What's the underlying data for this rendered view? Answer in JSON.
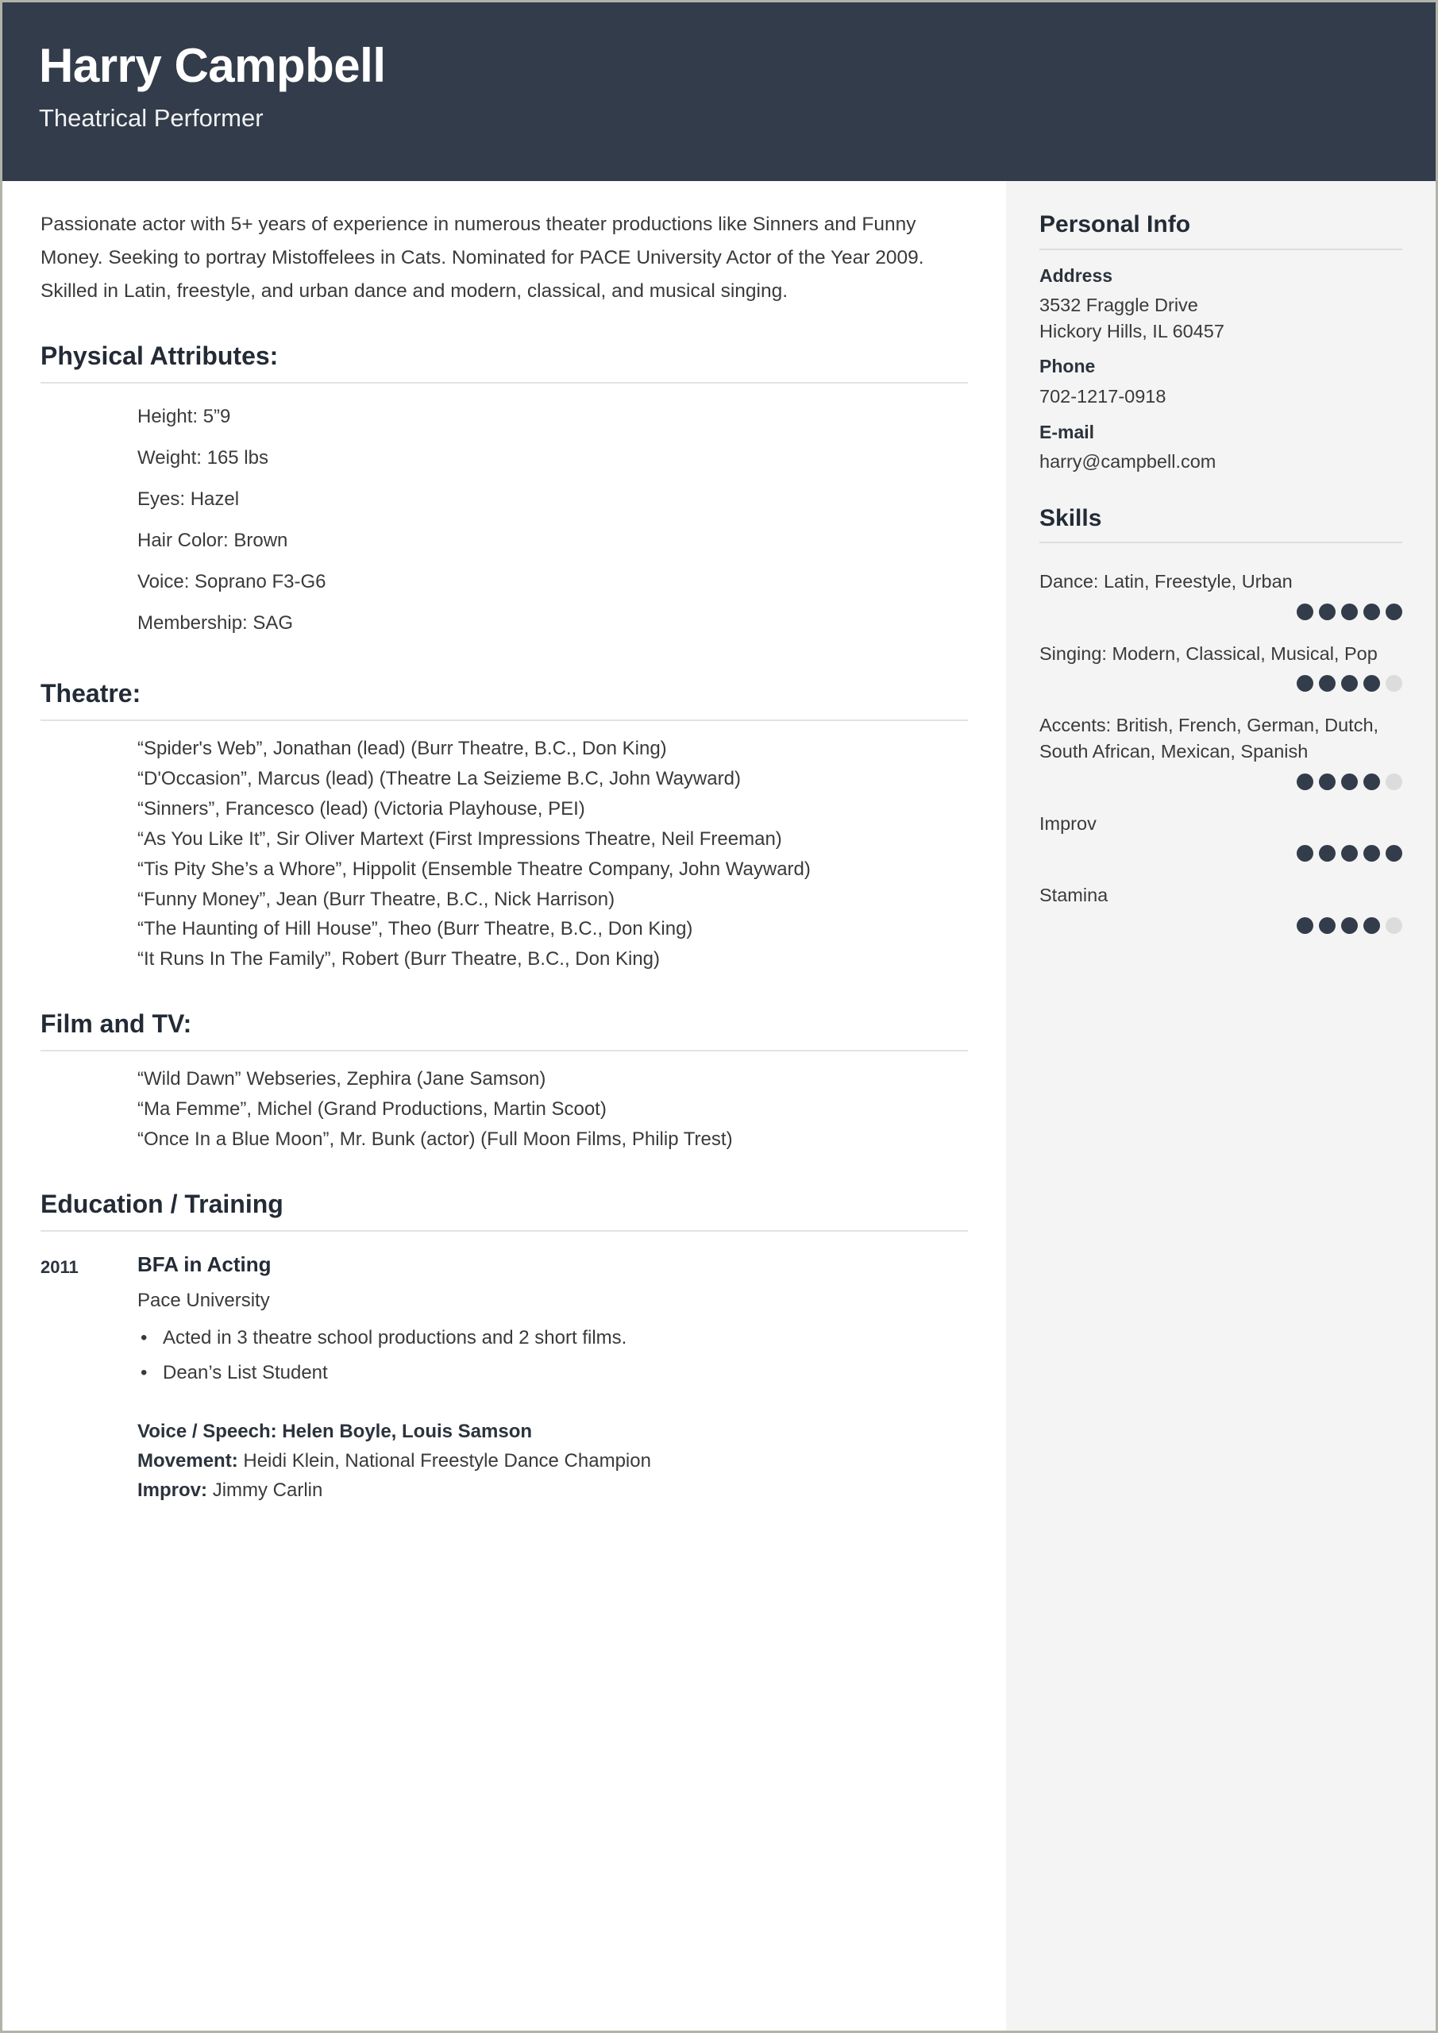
{
  "header": {
    "name": "Harry Campbell",
    "job_title": "Theatrical Performer",
    "background_color": "#333c4a",
    "text_color": "#ffffff"
  },
  "main": {
    "summary": "Passionate actor with 5+ years of experience in numerous theater productions like Sinners and Funny Money. Seeking to portray Mistoffelees in Cats. Nominated for PACE University Actor of the Year 2009. Skilled in Latin, freestyle, and urban dance and modern, classical, and musical singing.",
    "physical_attributes": {
      "heading": "Physical Attributes:",
      "items": [
        "Height: 5”9",
        "Weight: 165 lbs",
        "Eyes: Hazel",
        "Hair Color: Brown",
        "Voice: Soprano F3-G6",
        "Membership: SAG"
      ]
    },
    "theatre": {
      "heading": "Theatre:",
      "credits": [
        "“Spider's Web”, Jonathan (lead) (Burr Theatre, B.C., Don King)",
        "“D'Occasion”, Marcus (lead) (Theatre La Seizieme B.C, John Wayward)",
        "“Sinners”, Francesco (lead) (Victoria Playhouse, PEI)",
        "“As You Like It”, Sir Oliver Martext (First Impressions Theatre, Neil Freeman)",
        "“Tis Pity She’s a Whore”, Hippolit (Ensemble Theatre Company, John Wayward)",
        "“Funny Money”, Jean (Burr Theatre, B.C., Nick Harrison)",
        "“The Haunting of Hill House”, Theo (Burr Theatre, B.C., Don King)",
        "“It Runs In The Family”, Robert (Burr Theatre, B.C., Don King)"
      ]
    },
    "film_tv": {
      "heading": "Film and TV:",
      "credits": [
        "“Wild Dawn” Webseries, Zephira (Jane Samson)",
        "“Ma Femme”, Michel (Grand Productions, Martin Scoot)",
        "“Once In a Blue Moon”, Mr. Bunk (actor) (Full Moon Films, Philip Trest)"
      ]
    },
    "education": {
      "heading": "Education / Training",
      "entries": [
        {
          "year": "2011",
          "degree": "BFA in Acting",
          "school": "Pace University",
          "bullets": [
            "Acted in 3 theatre school productions and 2 short films.",
            "Dean’s List Student"
          ],
          "training": [
            {
              "label": "Voice / Speech:",
              "value": "Helen Boyle, Louis Samson",
              "bold_value": true
            },
            {
              "label": "Movement:",
              "value": "Heidi Klein, National Freestyle Dance Champion",
              "bold_value": false
            },
            {
              "label": "Improv:",
              "value": "Jimmy Carlin",
              "bold_value": false
            }
          ]
        }
      ]
    }
  },
  "sidebar": {
    "personal_info": {
      "heading": "Personal Info",
      "fields": [
        {
          "label": "Address",
          "value": "3532 Fraggle Drive\nHickory Hills, IL 60457"
        },
        {
          "label": "Phone",
          "value": "702-1217-0918"
        },
        {
          "label": "E-mail",
          "value": "harry@campbell.com"
        }
      ]
    },
    "skills": {
      "heading": "Skills",
      "max_rating": 5,
      "items": [
        {
          "name": "Dance: Latin, Freestyle, Urban",
          "rating": 5
        },
        {
          "name": "Singing: Modern, Classical, Musical, Pop",
          "rating": 4
        },
        {
          "name": "Accents: British, French, German, Dutch, South African, Mexican, Spanish",
          "rating": 4
        },
        {
          "name": "Improv",
          "rating": 5
        },
        {
          "name": "Stamina",
          "rating": 4
        }
      ],
      "dot_filled_color": "#333c4a",
      "dot_empty_color": "#dcdcdc"
    },
    "background_color": "#f4f4f4"
  }
}
